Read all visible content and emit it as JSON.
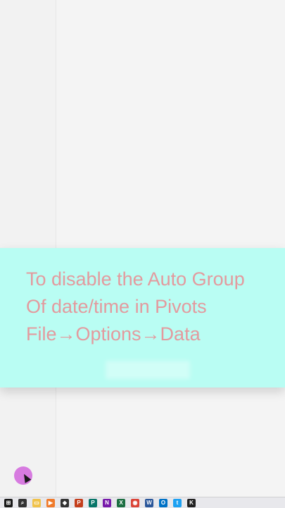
{
  "overlay": {
    "line1": "To disable the Auto Group",
    "line2": "Of date/time in Pivots",
    "line3": "File→Options→Data",
    "text_color": "#e39a9e",
    "background": "#b9fdf3"
  },
  "cursor": {
    "highlight_color": "#d77be0"
  },
  "taskbar": {
    "icons": [
      {
        "name": "windows-start-icon",
        "glyph": "⊞",
        "color": "#1a1a1a"
      },
      {
        "name": "search-icon",
        "glyph": "⌕",
        "color": "#333333"
      },
      {
        "name": "file-explorer-icon",
        "glyph": "▭",
        "color": "#f0c24a"
      },
      {
        "name": "media-player-icon",
        "glyph": "▶",
        "color": "#f07a2a"
      },
      {
        "name": "app-icon",
        "glyph": "◆",
        "color": "#333333"
      },
      {
        "name": "powerpoint-icon",
        "glyph": "P",
        "color": "#c43e1c"
      },
      {
        "name": "publisher-icon",
        "glyph": "P",
        "color": "#077568"
      },
      {
        "name": "onenote-icon",
        "glyph": "N",
        "color": "#7719aa"
      },
      {
        "name": "excel-icon",
        "glyph": "X",
        "color": "#1d6f42"
      },
      {
        "name": "chrome-icon",
        "glyph": "◉",
        "color": "#db4437"
      },
      {
        "name": "word-icon",
        "glyph": "W",
        "color": "#2b579a"
      },
      {
        "name": "outlook-icon",
        "glyph": "O",
        "color": "#0072c6"
      },
      {
        "name": "tweetdeck-icon",
        "glyph": "t",
        "color": "#1da1f2"
      },
      {
        "name": "app-k-icon",
        "glyph": "K",
        "color": "#222222"
      }
    ]
  }
}
